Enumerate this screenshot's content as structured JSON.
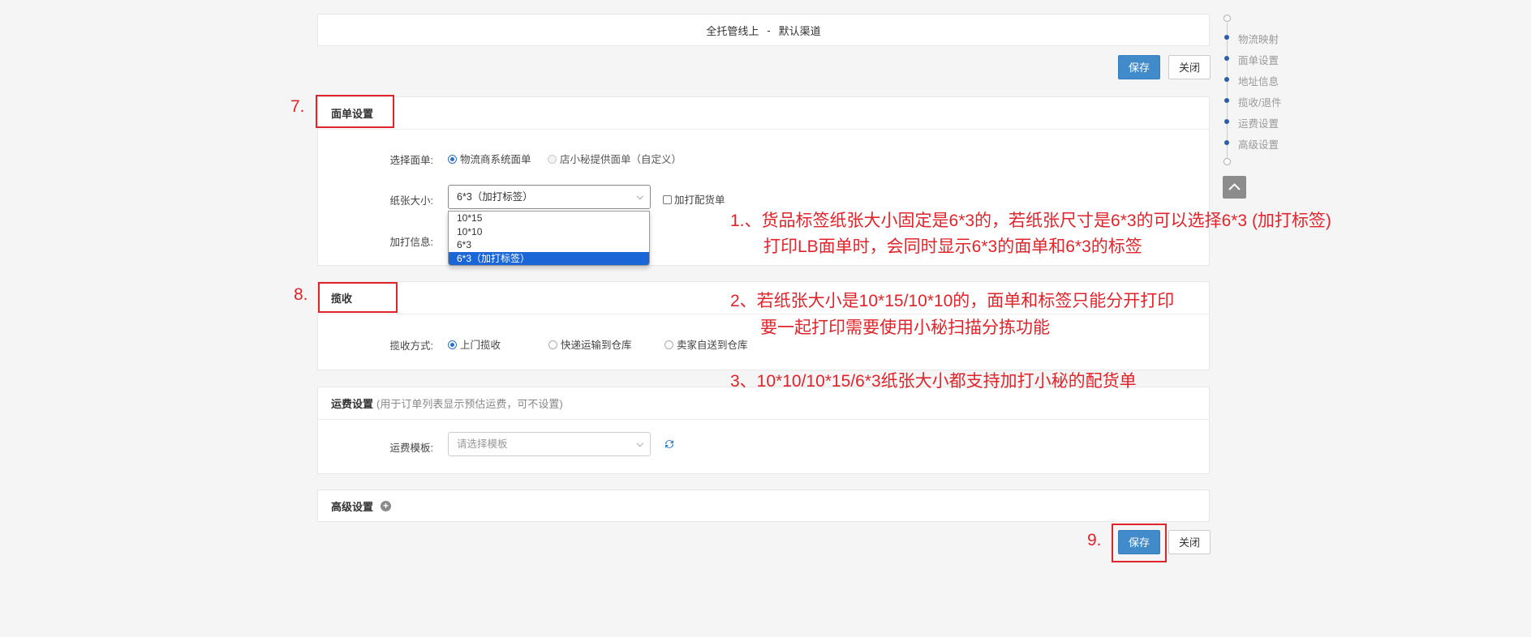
{
  "header": {
    "title": "全托管线上",
    "separator": "-",
    "channel": "默认渠道"
  },
  "actions": {
    "save": "保存",
    "close": "关闭"
  },
  "sections": {
    "waybill": {
      "title": "面单设置",
      "select_waybill_label": "选择面单:",
      "waybill_options": [
        "物流商系统面单",
        "店小秘提供面单（自定义）"
      ],
      "paper_size_label": "纸张大小:",
      "paper_size_value": "6*3（加打标签）",
      "paper_size_options": [
        "10*15",
        "10*10",
        "6*3",
        "6*3（加打标签）"
      ],
      "extra_print_checkbox": "加打配货单",
      "extra_info_label": "加打信息:"
    },
    "pickup": {
      "title": "揽收",
      "method_label": "揽收方式:",
      "options": [
        "上门揽收",
        "快递运输到仓库",
        "卖家自送到仓库"
      ]
    },
    "freight": {
      "title": "运费设置",
      "subtitle": "(用于订单列表显示预估运费，可不设置)",
      "template_label": "运费模板:",
      "template_placeholder": "请选择模板"
    },
    "advanced": {
      "title": "高级设置"
    }
  },
  "side_nav": {
    "items": [
      "物流映射",
      "面单设置",
      "地址信息",
      "揽收/退件",
      "运费设置",
      "高级设置"
    ]
  },
  "annotations": {
    "markers": [
      "7.",
      "8.",
      "9."
    ],
    "notes": [
      "1.、货品标签纸张大小固定是6*3的，若纸张尺寸是6*3的可以选择6*3 (加打标签)",
      "打印LB面单时，会同时显示6*3的面单和6*3的标签",
      "2、若纸张大小是10*15/10*10的，面单和标签只能分开打印",
      "要一起打印需要使用小秘扫描分拣功能",
      "3、10*10/10*15/6*3纸张大小都支持加打小秘的配货单"
    ]
  },
  "colors": {
    "primary": "#428bca",
    "annotation": "#e0242b",
    "selected_option": "#1a66d6"
  }
}
